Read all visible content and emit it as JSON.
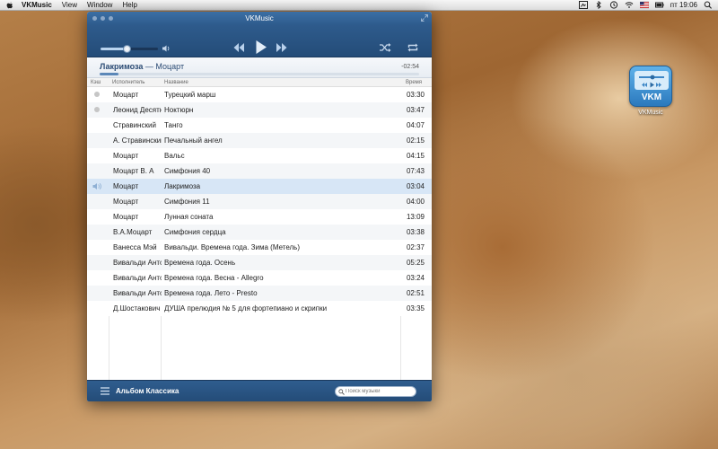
{
  "menubar": {
    "app_name": "VKMusic",
    "items": [
      "View",
      "Window",
      "Help"
    ],
    "tray": {
      "date_time": "пт 19:06"
    }
  },
  "window": {
    "title": "VKMusic",
    "player": {
      "volume_percent": 45,
      "now_playing": {
        "track": "Лакримоза",
        "separator": " — ",
        "artist": "Моцарт"
      },
      "remaining": "-02:54",
      "progress_percent": 6
    },
    "list_header": {
      "cache": "Кэш",
      "artist": "Исполнитель",
      "title": "Название",
      "time": "Время"
    },
    "tracks": [
      {
        "artist": "Моцарт",
        "title": "Турецкий марш",
        "time": "03:30",
        "cached": true
      },
      {
        "artist": "Леонид Десятн.",
        "title": "Ноктюрн",
        "time": "03:47",
        "cached": true
      },
      {
        "artist": "Стравинский",
        "title": "Танго",
        "time": "04:07"
      },
      {
        "artist": "А. Стравинский",
        "title": "Печальный ангел",
        "time": "02:15"
      },
      {
        "artist": "Моцарт",
        "title": "Вальс",
        "time": "04:15"
      },
      {
        "artist": "Моцарт В. А",
        "title": "Симфония  40",
        "time": "07:43"
      },
      {
        "artist": "Моцарт",
        "title": "Лакримоза",
        "time": "03:04",
        "playing": true
      },
      {
        "artist": "Моцарт",
        "title": "Симфония 11",
        "time": "04:00"
      },
      {
        "artist": "Моцарт",
        "title": "Лунная соната",
        "time": "13:09"
      },
      {
        "artist": "В.А.Моцарт",
        "title": "Симфония сердца",
        "time": "03:38"
      },
      {
        "artist": "Ванесса Мэй",
        "title": "Вивальди. Времена года. Зима (Метель)",
        "time": "02:37"
      },
      {
        "artist": "Вивальди Антонио",
        "title": "Времена года. Осень",
        "time": "05:25"
      },
      {
        "artist": "Вивальди Антонио",
        "title": "Времена года. Весна - Allegro",
        "time": "03:24"
      },
      {
        "artist": "Вивальди Антонио",
        "title": "Времена года. Лето - Presto",
        "time": "02:51"
      },
      {
        "artist": "Д.Шостакович",
        "title": "ДУША прелюдия № 5 для фортепиано и скрипки",
        "time": "03:35"
      }
    ],
    "footer": {
      "album": "Альбом Классика",
      "search_placeholder": "Поиск музыки"
    }
  },
  "desktop_icon": {
    "icon_text": "VKM",
    "label": "VKMusic"
  },
  "colors": {
    "accent": "#2e5b8c",
    "active_row": "#d7e6f6"
  }
}
